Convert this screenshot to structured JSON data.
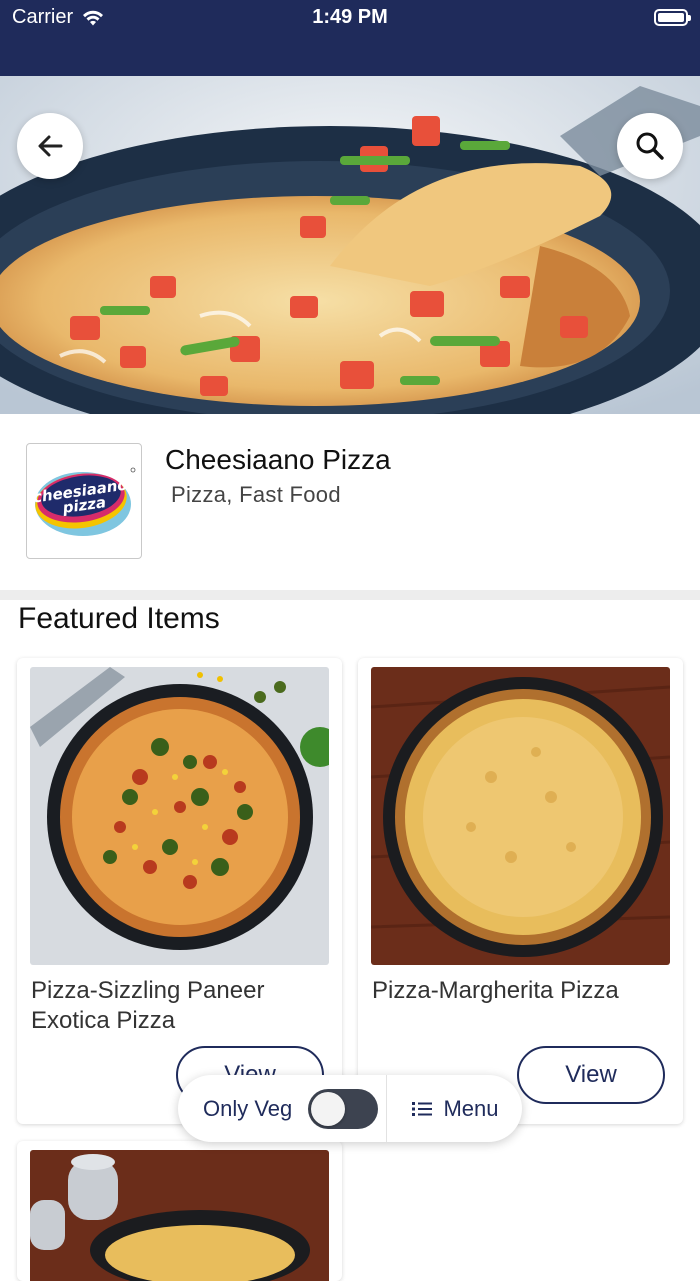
{
  "status_bar": {
    "carrier": "Carrier",
    "time": "1:49 PM"
  },
  "header": {
    "back_icon": "arrow-left-icon",
    "search_icon": "search-icon"
  },
  "restaurant": {
    "name": "Cheesiaano Pizza",
    "cuisine": "Pizza, Fast Food",
    "logo_text_line1": "cheesiaano",
    "logo_text_line2": "pizza"
  },
  "featured": {
    "title": "Featured Items",
    "items": [
      {
        "name": "Pizza-Sizzling Paneer Exotica Pizza",
        "button": "View"
      },
      {
        "name": "Pizza-Margherita Pizza",
        "button": "View"
      },
      {
        "name": "",
        "button": ""
      }
    ]
  },
  "filter_bar": {
    "only_veg_label": "Only Veg",
    "only_veg_on": false,
    "menu_label": "Menu",
    "menu_icon": "list-icon"
  },
  "colors": {
    "brand": "#1f2b5b",
    "divider": "#ededed"
  }
}
